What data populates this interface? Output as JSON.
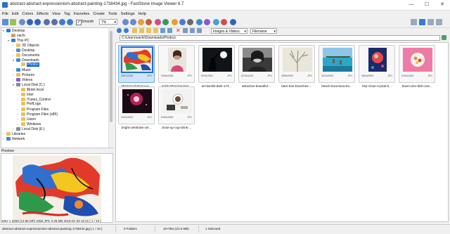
{
  "window": {
    "title": "abstract-abstract-expressionism-abstract-painting-1738434.jpg - FastStone Image Viewer 6.7",
    "controls": {
      "minimize": "—",
      "maximize": "☐",
      "close": "✕"
    }
  },
  "menu": [
    "File",
    "Edit",
    "Colors",
    "Effects",
    "View",
    "Tag",
    "Favorites",
    "Create",
    "Tools",
    "Settings",
    "Help"
  ],
  "toolbar": {
    "smooth_label": "Smooth",
    "smooth_checked": true,
    "zoom_value": "7%"
  },
  "tree": {
    "items": [
      {
        "label": "Desktop",
        "icon": "desktop-icon",
        "color": "#2d7ad6"
      },
      {
        "label": "vachi",
        "icon": "user-icon",
        "color": "#c9a06a"
      },
      {
        "label": "This PC",
        "icon": "computer-icon",
        "color": "#3b7fc9"
      },
      {
        "label": "3D Objects",
        "icon": "folder-icon",
        "color": "#e8c25a"
      },
      {
        "label": "Desktop",
        "icon": "folder-icon",
        "color": "#4a8fe0"
      },
      {
        "label": "Documents",
        "icon": "folder-icon",
        "color": "#e8c25a"
      },
      {
        "label": "Downloads",
        "icon": "download-folder-icon",
        "color": "#3b8ad8"
      },
      {
        "label": "Photos",
        "icon": "folder-icon",
        "color": "#e8c25a"
      },
      {
        "label": "Music",
        "icon": "music-icon",
        "color": "#3b8ad8"
      },
      {
        "label": "Pictures",
        "icon": "pictures-icon",
        "color": "#e8c25a"
      },
      {
        "label": "Videos",
        "icon": "video-icon",
        "color": "#8a5ad6"
      },
      {
        "label": "Local Disk (C:)",
        "icon": "drive-icon",
        "color": "#7f8c9a"
      },
      {
        "label": "$Intel.local",
        "icon": "folder-icon",
        "color": "#e8c25a"
      },
      {
        "label": "Intel",
        "icon": "folder-icon",
        "color": "#e8c25a"
      },
      {
        "label": "iTunes_Control",
        "icon": "folder-icon",
        "color": "#e8c25a"
      },
      {
        "label": "PerfLogs",
        "icon": "folder-icon",
        "color": "#e8c25a"
      },
      {
        "label": "Program Files",
        "icon": "folder-icon",
        "color": "#e8c25a"
      },
      {
        "label": "Program Files (x86)",
        "icon": "folder-icon",
        "color": "#e8c25a"
      },
      {
        "label": "Users",
        "icon": "folder-icon",
        "color": "#e8c25a"
      },
      {
        "label": "Windows",
        "icon": "folder-icon",
        "color": "#e8c25a"
      },
      {
        "label": "Local Disk (E:)",
        "icon": "drive-icon",
        "color": "#7f8c9a"
      },
      {
        "label": "Libraries",
        "icon": "library-icon",
        "color": "#e8c25a"
      },
      {
        "label": "Network",
        "icon": "network-icon",
        "color": "#3b8ad8"
      }
    ]
  },
  "preview": {
    "label": "Preview",
    "info": "4067 x 3259 (13.65 MP)  24bit  JPG   3.26 MB   2019-01-03 12:41  [ 1 / 10 ]"
  },
  "browser": {
    "filter_value": "Images & Videos",
    "sort_value": "Filename",
    "path": "C:\\Users\\vachi\\Downloads\\Photos\\",
    "thumbnails": [
      {
        "name": "abstract-abstract-ex...",
        "dims": "4067x3259",
        "format": "JPG",
        "selected": true
      },
      {
        "name": "adult-attractive-bea...",
        "dims": "2848x4288",
        "format": "JPG",
        "selected": false
      },
      {
        "name": "art-backlit-dark-173...",
        "dims": "5040x3361",
        "format": "JPG",
        "selected": false
      },
      {
        "name": "attractive-beautiful-...",
        "dims": "6240x4160",
        "format": "JPG",
        "selected": false
      },
      {
        "name": "bare-tree-branches-...",
        "dims": "3888x2592",
        "format": "JPG",
        "selected": false
      },
      {
        "name": "beach-bora-bora-bo...",
        "dims": "4000x3000",
        "format": "JPG",
        "selected": false
      },
      {
        "name": "blur-close-crystal-b...",
        "dims": "3584x5559",
        "format": "JPG",
        "selected": false
      },
      {
        "name": "bowl-color-dish-116...",
        "dims": "5184x3456",
        "format": "JPG",
        "selected": false
      },
      {
        "name": "bright-celebrate-cel...",
        "dims": "4000x3000",
        "format": "JPG",
        "selected": false
      },
      {
        "name": "close-up-cup-drink-...",
        "dims": "5184x3456",
        "format": "JPG",
        "selected": false
      }
    ]
  },
  "status": {
    "filename": "abstract-abstract-expressionism-abstract-painting-1738434.jpg [ 1 / 10 ]",
    "folders": "0 Folders",
    "files": "10 Files (21.6 MB)",
    "selected": "1 Selected"
  },
  "colors": {
    "accent": "#0a64d8",
    "selection": "#cde4fb"
  }
}
